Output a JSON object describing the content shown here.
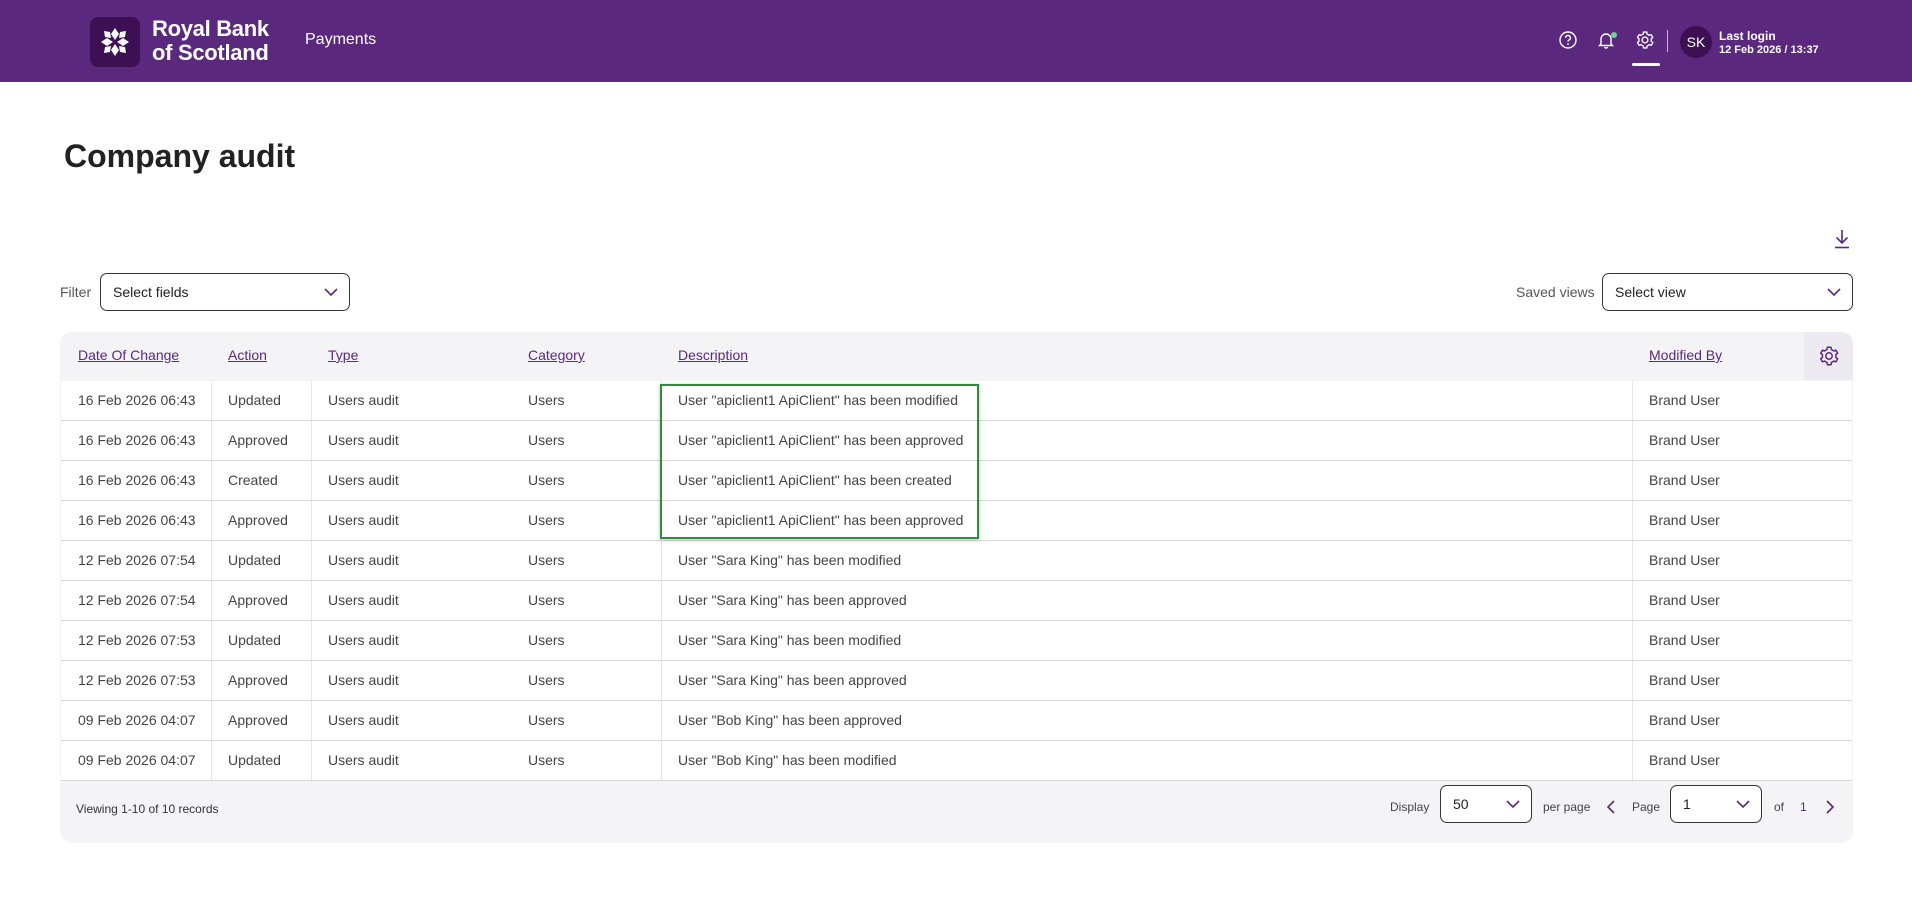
{
  "header": {
    "brand_line1": "Royal Bank",
    "brand_line2": "of Scotland",
    "nav_payments": "Payments",
    "avatar_initials": "SK",
    "last_login_title": "Last login",
    "last_login_time": "12 Feb 2026 / 13:37",
    "icons": [
      "help-icon",
      "bell-icon",
      "gear-icon"
    ]
  },
  "page": {
    "title": "Company audit"
  },
  "filters": {
    "filter_label": "Filter",
    "filter_value": "Select fields",
    "saved_views_label": "Saved views",
    "saved_views_value": "Select view"
  },
  "table": {
    "headers": [
      "Date Of Change",
      "Action",
      "Type",
      "Category",
      "Description",
      "Modified By"
    ],
    "rows": [
      [
        "16 Feb 2026 06:43",
        "Updated",
        "Users audit",
        "Users",
        "User \"apiclient1 ApiClient\" has been modified",
        "Brand User"
      ],
      [
        "16 Feb 2026 06:43",
        "Approved",
        "Users audit",
        "Users",
        "User \"apiclient1 ApiClient\" has been approved",
        "Brand User"
      ],
      [
        "16 Feb 2026 06:43",
        "Created",
        "Users audit",
        "Users",
        "User \"apiclient1 ApiClient\" has been created",
        "Brand User"
      ],
      [
        "16 Feb 2026 06:43",
        "Approved",
        "Users audit",
        "Users",
        "User \"apiclient1 ApiClient\" has been approved",
        "Brand User"
      ],
      [
        "12 Feb 2026 07:54",
        "Updated",
        "Users audit",
        "Users",
        "User \"Sara King\" has been modified",
        "Brand User"
      ],
      [
        "12 Feb 2026 07:54",
        "Approved",
        "Users audit",
        "Users",
        "User \"Sara King\" has been approved",
        "Brand User"
      ],
      [
        "12 Feb 2026 07:53",
        "Updated",
        "Users audit",
        "Users",
        "User \"Sara King\" has been modified",
        "Brand User"
      ],
      [
        "12 Feb 2026 07:53",
        "Approved",
        "Users audit",
        "Users",
        "User \"Sara King\" has been approved",
        "Brand User"
      ],
      [
        "09 Feb 2026 04:07",
        "Approved",
        "Users audit",
        "Users",
        "User \"Bob King\" has been approved",
        "Brand User"
      ],
      [
        "09 Feb 2026 04:07",
        "Updated",
        "Users audit",
        "Users",
        "User \"Bob King\" has been modified",
        "Brand User"
      ]
    ]
  },
  "pagination": {
    "viewing": "Viewing 1-10 of 10 records",
    "display_label": "Display",
    "per_page_value": "50",
    "per_page_label": "per page",
    "page_label": "Page",
    "page_value": "1",
    "of_label": "of",
    "total_pages": "1"
  },
  "colors": {
    "brand_purple": "#5a287d",
    "brand_dark": "#3c1053",
    "highlight_green": "#2e8b3a"
  }
}
